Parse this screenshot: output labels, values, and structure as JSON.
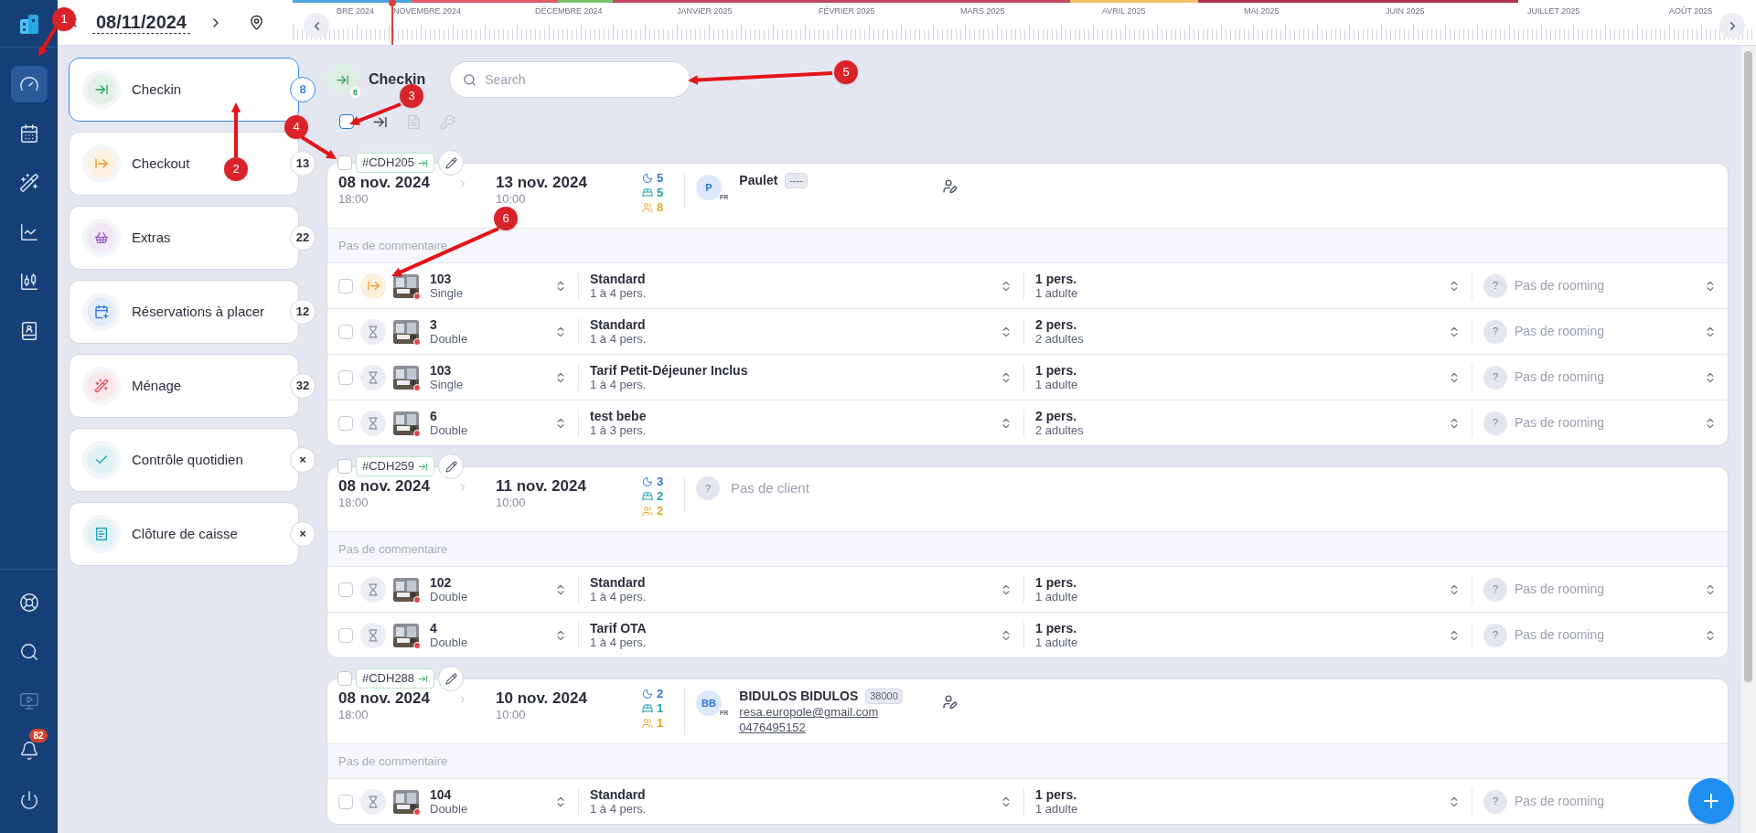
{
  "nav": {
    "top": [
      {
        "selected": true,
        "disabled": false
      },
      {
        "selected": false,
        "disabled": false
      },
      {
        "selected": false,
        "disabled": false
      },
      {
        "selected": false,
        "disabled": false
      },
      {
        "selected": false,
        "disabled": false
      },
      {
        "selected": false,
        "disabled": false
      }
    ],
    "bottom": [
      {
        "selected": false,
        "disabled": false
      },
      {
        "selected": false,
        "disabled": false
      },
      {
        "selected": false,
        "disabled": true
      },
      {
        "selected": false,
        "disabled": false,
        "badge": "82"
      },
      {
        "selected": false,
        "disabled": false
      }
    ]
  },
  "date_bar": {
    "date": "08/11/2024"
  },
  "timeline": {
    "months": [
      "BRE 2024",
      "NOVEMBRE 2024",
      "DÉCEMBRE 2024",
      "JANVIER 2025",
      "FÉVRIER 2025",
      "MARS 2025",
      "AVRIL 2025",
      "MAI 2025",
      "JUIN 2025",
      "JUILLET 2025",
      "AOÛT 2025"
    ]
  },
  "menu": [
    {
      "label": "Checkin",
      "count": "8",
      "selected": true,
      "color": "#22a05a"
    },
    {
      "label": "Checkout",
      "count": "13",
      "selected": false,
      "color": "#f29a1f"
    },
    {
      "label": "Extras",
      "count": "22",
      "selected": false,
      "color": "#9a5cc4"
    },
    {
      "label": "Réservations à placer",
      "count": "12",
      "selected": false,
      "color": "#2a73d9"
    },
    {
      "label": "Ménage",
      "count": "32",
      "selected": false,
      "color": "#e0555f"
    },
    {
      "label": "Contrôle quotidien",
      "count": "×",
      "selected": false,
      "color": "#1f9fb3"
    },
    {
      "label": "Clôture de caisse",
      "count": "×",
      "selected": false,
      "color": "#1f9fb3"
    }
  ],
  "header": {
    "title": "Checkin",
    "count": "8",
    "search": {
      "placeholder": "Search"
    }
  },
  "toolbar": {
    "select_all": {
      "checked": false
    },
    "actions": [
      {
        "kind": "arrow",
        "disabled": false
      },
      {
        "kind": "document",
        "disabled": true
      },
      {
        "kind": "key",
        "disabled": true
      }
    ]
  },
  "reservations": [
    {
      "ref": "#CDH205",
      "selected": false,
      "arrival": {
        "date": "08 nov. 2024",
        "time": "18:00"
      },
      "departure": {
        "date": "13 nov. 2024",
        "time": "10:00"
      },
      "nights": "5",
      "beds": "5",
      "guests": "8",
      "client": {
        "kind": "guest",
        "initials": "P",
        "country": "FR",
        "name": "Paulet",
        "tag": "----"
      },
      "comment": "Pas de commentaire",
      "rows": [
        {
          "kind": "checkout",
          "room": "103",
          "room_type": "Single",
          "rate": "Standard",
          "capacity": "1 à 4 pers.",
          "persons": "1 pers.",
          "adults": "1 adulte",
          "rooming_initial": "?",
          "rooming": "Pas de rooming",
          "selected": false
        },
        {
          "kind": "waiting",
          "room": "3",
          "room_type": "Double",
          "rate": "Standard",
          "capacity": "1 à 4 pers.",
          "persons": "2 pers.",
          "adults": "2 adultes",
          "rooming_initial": "?",
          "rooming": "Pas de rooming",
          "selected": false
        },
        {
          "kind": "waiting",
          "room": "103",
          "room_type": "Single",
          "rate": "Tarif Petit-Déjeuner Inclus",
          "capacity": "1 à 4 pers.",
          "persons": "1 pers.",
          "adults": "1 adulte",
          "rooming_initial": "?",
          "rooming": "Pas de rooming",
          "selected": false
        },
        {
          "kind": "waiting",
          "room": "6",
          "room_type": "Double",
          "rate": "test bebe",
          "capacity": "1 à 3 pers.",
          "persons": "2 pers.",
          "adults": "2 adultes",
          "rooming_initial": "?",
          "rooming": "Pas de rooming",
          "selected": false
        }
      ]
    },
    {
      "ref": "#CDH259",
      "selected": false,
      "arrival": {
        "date": "08 nov. 2024",
        "time": "18:00"
      },
      "departure": {
        "date": "11 nov. 2024",
        "time": "10:00"
      },
      "nights": "3",
      "beds": "2",
      "guests": "2",
      "client": {
        "kind": "none",
        "initials": "?",
        "name": "Pas de client"
      },
      "comment": "Pas de commentaire",
      "rows": [
        {
          "kind": "waiting",
          "room": "102",
          "room_type": "Double",
          "rate": "Standard",
          "capacity": "1 à 4 pers.",
          "persons": "1 pers.",
          "adults": "1 adulte",
          "rooming_initial": "?",
          "rooming": "Pas de rooming",
          "selected": false
        },
        {
          "kind": "waiting",
          "room": "4",
          "room_type": "Double",
          "rate": "Tarif OTA",
          "capacity": "1 à 4 pers.",
          "persons": "1 pers.",
          "adults": "1 adulte",
          "rooming_initial": "?",
          "rooming": "Pas de rooming",
          "selected": false
        }
      ]
    },
    {
      "ref": "#CDH288",
      "selected": false,
      "arrival": {
        "date": "08 nov. 2024",
        "time": "18:00"
      },
      "departure": {
        "date": "10 nov. 2024",
        "time": "10:00"
      },
      "nights": "2",
      "beds": "1",
      "guests": "1",
      "client": {
        "kind": "guest",
        "initials": "BB",
        "country": "FR",
        "name": "BIDULOS BIDULOS",
        "tag": "38000",
        "email": "resa.europole@gmail.com",
        "phone": "0476495152"
      },
      "comment": "Pas de commentaire",
      "rows": [
        {
          "kind": "waiting",
          "room": "104",
          "room_type": "Double",
          "rate": "Standard",
          "capacity": "1 à 4 pers.",
          "persons": "1 pers.",
          "adults": "1 adulte",
          "rooming_initial": "?",
          "rooming": "Pas de rooming",
          "selected": false
        }
      ]
    }
  ],
  "annotations": [
    "1",
    "2",
    "3",
    "4",
    "5",
    "6"
  ]
}
